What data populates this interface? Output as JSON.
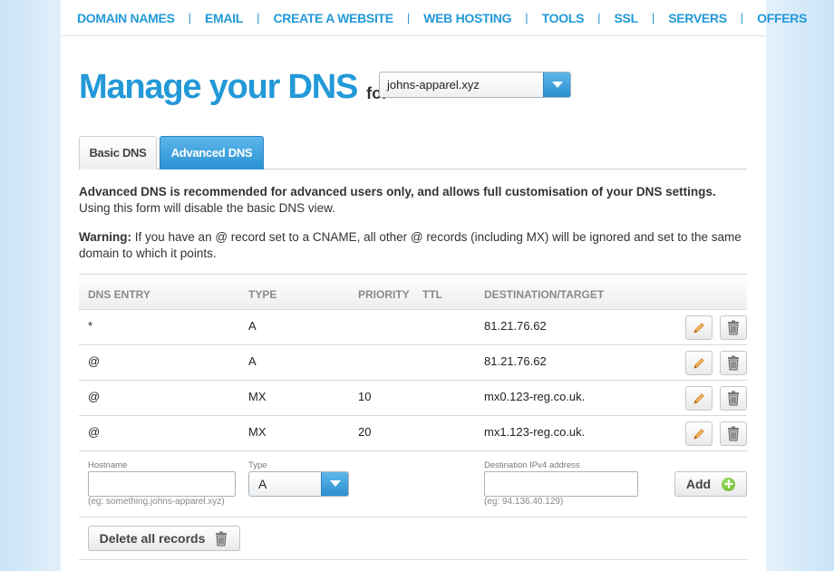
{
  "nav": {
    "items": [
      "DOMAIN NAMES",
      "EMAIL",
      "CREATE A WEBSITE",
      "WEB HOSTING",
      "TOOLS",
      "SSL",
      "SERVERS",
      "OFFERS"
    ],
    "separator": "|"
  },
  "heading": {
    "title": "Manage your DNS",
    "for_label": "for",
    "domain_selected": "johns-apparel.xyz"
  },
  "tabs": {
    "basic": "Basic DNS",
    "advanced": "Advanced DNS",
    "active": "advanced"
  },
  "intro": {
    "bold": "Advanced DNS is recommended for advanced users only, and allows full customisation of your DNS settings.",
    "normal": "Using this form will disable the basic DNS view."
  },
  "warning": {
    "label": "Warning:",
    "text": "If you have an @ record set to a CNAME, all other @ records (including MX) will be ignored and set to the same domain to which it points."
  },
  "table": {
    "headers": {
      "entry": "DNS ENTRY",
      "type": "TYPE",
      "priority": "PRIORITY",
      "ttl": "TTL",
      "destination": "DESTINATION/TARGET"
    },
    "rows": [
      {
        "entry": "*",
        "type": "A",
        "priority": "",
        "ttl": "",
        "destination": "81.21.76.62"
      },
      {
        "entry": "@",
        "type": "A",
        "priority": "",
        "ttl": "",
        "destination": "81.21.76.62"
      },
      {
        "entry": "@",
        "type": "MX",
        "priority": "10",
        "ttl": "",
        "destination": "mx0.123-reg.co.uk."
      },
      {
        "entry": "@",
        "type": "MX",
        "priority": "20",
        "ttl": "",
        "destination": "mx1.123-reg.co.uk."
      }
    ]
  },
  "addform": {
    "hostname_label": "Hostname",
    "hostname_value": "",
    "hostname_hint": "(eg: something.johns-apparel.xyz)",
    "type_label": "Type",
    "type_value": "A",
    "destination_label": "Destination IPv4 address",
    "destination_value": "",
    "destination_hint": "(eg: 94.136.40.129)",
    "add_label": "Add"
  },
  "delete_all_label": "Delete all records",
  "colors": {
    "brand_blue": "#2399d8",
    "add_green": "#5fb52a"
  },
  "icons": {
    "edit": "pencil-icon",
    "delete": "trash-icon",
    "add": "plus-circle-icon",
    "dropdown": "chevron-down-icon"
  }
}
